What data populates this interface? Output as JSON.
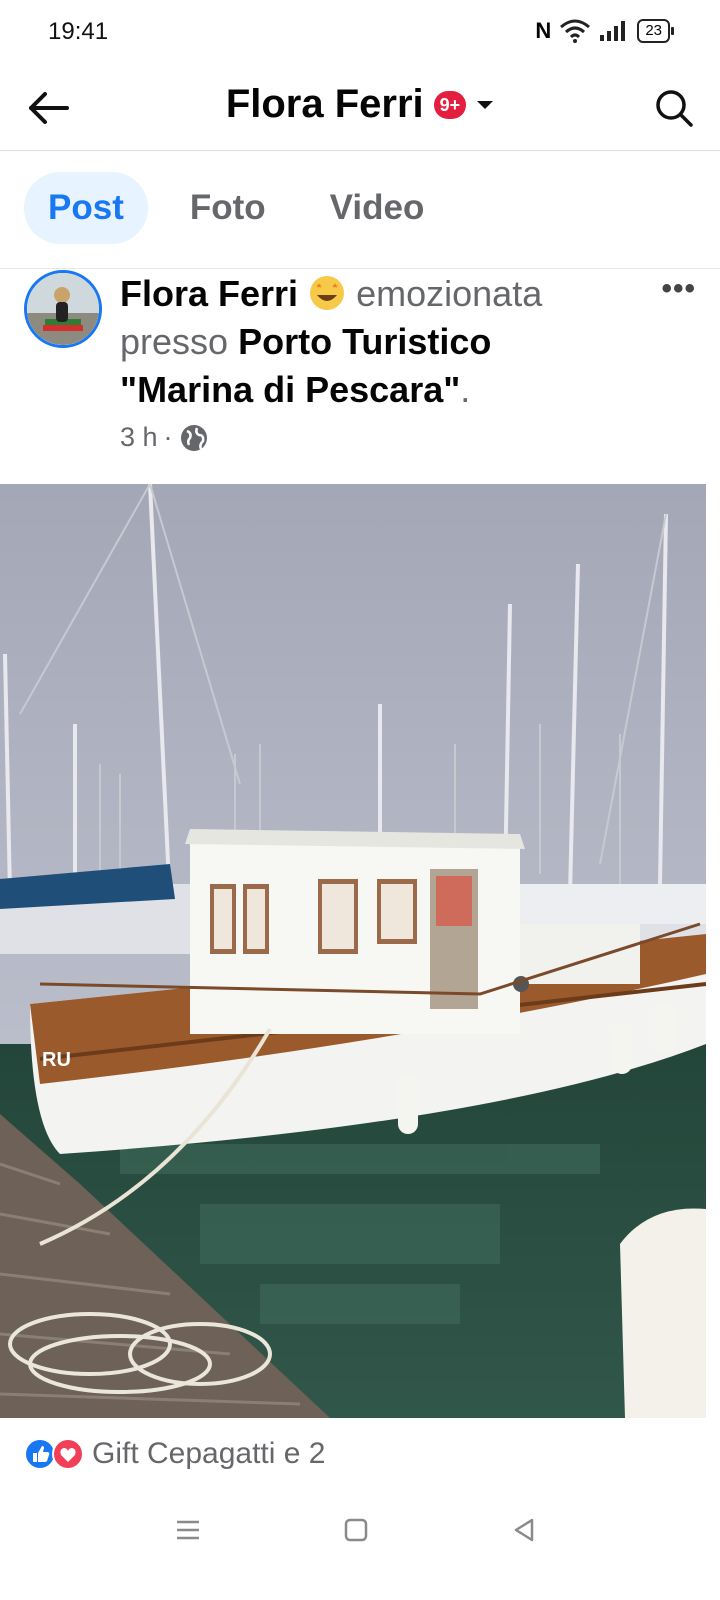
{
  "status_bar": {
    "time": "19:41",
    "battery": "23"
  },
  "header": {
    "title": "Flora Ferri",
    "badge": "9+"
  },
  "tabs": [
    {
      "label": "Post",
      "active": true
    },
    {
      "label": "Foto",
      "active": false
    },
    {
      "label": "Video",
      "active": false
    }
  ],
  "post": {
    "author": "Flora Ferri",
    "feeling": "emozionata",
    "at_word": "presso",
    "location": "Porto Turistico \"Marina di Pescara\"",
    "period": ".",
    "time": "3 h",
    "separator": "·",
    "privacy_icon": "globe-icon",
    "reactions_text": "Gift Cepagatti e 2"
  },
  "colors": {
    "accent": "#1877f2",
    "badge": "#e41e3f",
    "secondary_text": "#65676b"
  }
}
